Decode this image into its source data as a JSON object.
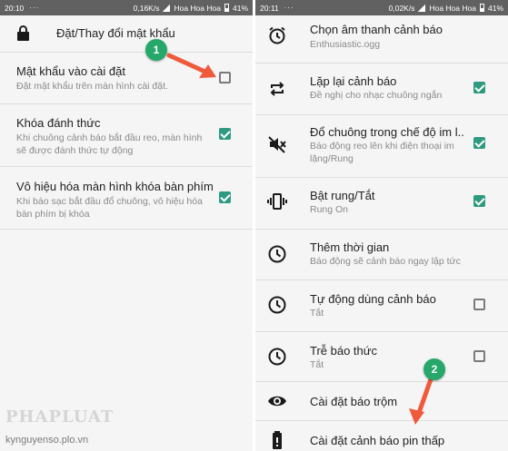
{
  "left_screen": {
    "status_bar": {
      "time": "20:10",
      "net_speed": "0,16K/s",
      "carrier": "Hoa Hoa Hoa",
      "battery": "41%"
    },
    "header": {
      "icon": "lock-icon",
      "title": "Đặt/Thay đổi mật khẩu"
    },
    "items": [
      {
        "title": "Mật khẩu vào cài đặt",
        "subtitle": "Đặt mật khẩu trên màn hình cài đặt.",
        "checked": false
      },
      {
        "title": "Khóa đánh thức",
        "subtitle": "Khi chuông cảnh báo bắt đầu reo, màn hình sẽ được đánh thức tự động",
        "checked": true
      },
      {
        "title": "Vô hiệu hóa màn hình khóa bàn phím",
        "subtitle": "Khi báo sạc bắt đầu đổ chuông, vô hiệu hóa bàn phím bị khóa",
        "checked": true
      }
    ],
    "callout": "1"
  },
  "right_screen": {
    "status_bar": {
      "time": "20:11",
      "net_speed": "0,02K/s",
      "carrier": "Hoa Hoa Hoa",
      "battery": "41%"
    },
    "items": [
      {
        "icon": "alarm-clock-icon",
        "title": "Chọn âm thanh cảnh báo",
        "subtitle": "Enthusiastic.ogg",
        "checkbox": null
      },
      {
        "icon": "repeat-icon",
        "title": "Lặp lại cảnh báo",
        "subtitle": "Đề nghị cho nhạc chuông ngắn",
        "checkbox": true
      },
      {
        "icon": "volume-off-icon",
        "title": "Đổ chuông trong chế độ im l..",
        "subtitle": "Báo động reo lên khi điện thoại im lặng/Rung",
        "checkbox": true
      },
      {
        "icon": "vibrate-icon",
        "title": "Bật rung/Tắt",
        "subtitle": "Rung On",
        "checkbox": true
      },
      {
        "icon": "clock-icon",
        "title": "Thêm thời gian",
        "subtitle": "Báo động sẽ cảnh báo ngay lập tức",
        "checkbox": null
      },
      {
        "icon": "clock-icon",
        "title": "Tự động dùng cảnh báo",
        "subtitle": "Tắt",
        "checkbox": false
      },
      {
        "icon": "clock-icon",
        "title": "Trễ báo thức",
        "subtitle": "Tắt",
        "checkbox": false
      },
      {
        "icon": "eye-icon",
        "title": "Cài đặt báo trộm",
        "subtitle": "",
        "checkbox": null
      },
      {
        "icon": "battery-icon",
        "title": "Cài đặt cảnh báo pin thấp",
        "subtitle": "",
        "checkbox": null
      }
    ],
    "callout": "2"
  },
  "watermark": {
    "logo": "PHAPLUAT",
    "url": "kynguyenso.plo.vn"
  },
  "colors": {
    "accent": "#2e9a80",
    "status_bar": "#616161",
    "callout": "#26a86a",
    "arrow": "#f05a3c",
    "panel_bg": "#f5f5f5"
  }
}
